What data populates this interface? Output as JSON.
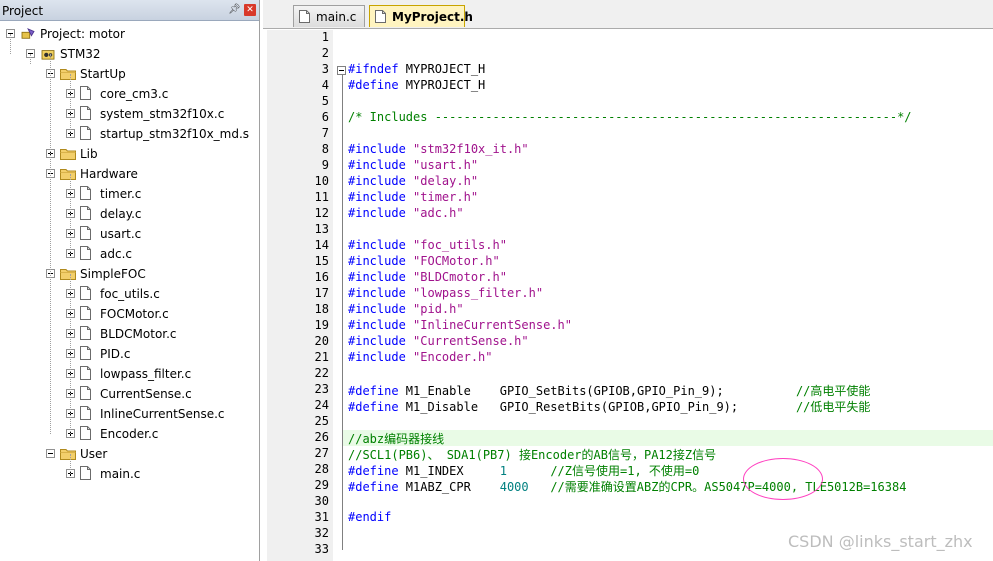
{
  "panel": {
    "title": "Project",
    "pin_icon": "pin-icon",
    "close_icon": "close-icon",
    "tree": {
      "project_label": "Project: motor",
      "target_label": "STM32",
      "groups": [
        {
          "label": "StartUp",
          "files": [
            "core_cm3.c",
            "system_stm32f10x.c",
            "startup_stm32f10x_md.s"
          ]
        },
        {
          "label": "Lib",
          "files": []
        },
        {
          "label": "Hardware",
          "files": [
            "timer.c",
            "delay.c",
            "usart.c",
            "adc.c"
          ]
        },
        {
          "label": "SimpleFOC",
          "files": [
            "foc_utils.c",
            "FOCMotor.c",
            "BLDCMotor.c",
            "PID.c",
            "lowpass_filter.c",
            "CurrentSense.c",
            "InlineCurrentSense.c",
            "Encoder.c"
          ]
        },
        {
          "label": "User",
          "files": [
            "main.c"
          ]
        }
      ]
    }
  },
  "tabs": [
    {
      "label": "main.c",
      "active": false
    },
    {
      "label": "MyProject.h",
      "active": true
    }
  ],
  "editor": {
    "line_numbers": [
      "1",
      "2",
      "3",
      "4",
      "5",
      "6",
      "7",
      "8",
      "9",
      "10",
      "11",
      "12",
      "13",
      "14",
      "15",
      "16",
      "17",
      "18",
      "19",
      "20",
      "21",
      "22",
      "23",
      "24",
      "25",
      "26",
      "27",
      "28",
      "29",
      "30",
      "31",
      "32",
      "33"
    ],
    "lines": [
      [],
      [],
      [
        [
          "kw",
          "#ifndef"
        ],
        [
          "p",
          " MYPROJECT_H"
        ]
      ],
      [
        [
          "kw",
          "#define"
        ],
        [
          "p",
          " MYPROJECT_H"
        ]
      ],
      [],
      [
        [
          "cmt",
          "/* Includes ----------------------------------------------------------------*/"
        ]
      ],
      [],
      [
        [
          "kw",
          "#include"
        ],
        [
          "p",
          " "
        ],
        [
          "str",
          "\"stm32f10x_it.h\""
        ]
      ],
      [
        [
          "kw",
          "#include"
        ],
        [
          "p",
          " "
        ],
        [
          "str",
          "\"usart.h\""
        ]
      ],
      [
        [
          "kw",
          "#include"
        ],
        [
          "p",
          " "
        ],
        [
          "str",
          "\"delay.h\""
        ]
      ],
      [
        [
          "kw",
          "#include"
        ],
        [
          "p",
          " "
        ],
        [
          "str",
          "\"timer.h\""
        ]
      ],
      [
        [
          "kw",
          "#include"
        ],
        [
          "p",
          " "
        ],
        [
          "str",
          "\"adc.h\""
        ]
      ],
      [],
      [
        [
          "kw",
          "#include"
        ],
        [
          "p",
          " "
        ],
        [
          "str",
          "\"foc_utils.h\""
        ]
      ],
      [
        [
          "kw",
          "#include"
        ],
        [
          "p",
          " "
        ],
        [
          "str",
          "\"FOCMotor.h\""
        ]
      ],
      [
        [
          "kw",
          "#include"
        ],
        [
          "p",
          " "
        ],
        [
          "str",
          "\"BLDCmotor.h\""
        ]
      ],
      [
        [
          "kw",
          "#include"
        ],
        [
          "p",
          " "
        ],
        [
          "str",
          "\"lowpass_filter.h\""
        ]
      ],
      [
        [
          "kw",
          "#include"
        ],
        [
          "p",
          " "
        ],
        [
          "str",
          "\"pid.h\""
        ]
      ],
      [
        [
          "kw",
          "#include"
        ],
        [
          "p",
          " "
        ],
        [
          "str",
          "\"InlineCurrentSense.h\""
        ]
      ],
      [
        [
          "kw",
          "#include"
        ],
        [
          "p",
          " "
        ],
        [
          "str",
          "\"CurrentSense.h\""
        ]
      ],
      [
        [
          "kw",
          "#include"
        ],
        [
          "p",
          " "
        ],
        [
          "str",
          "\"Encoder.h\""
        ]
      ],
      [],
      [
        [
          "kw",
          "#define"
        ],
        [
          "p",
          " M1_Enable    GPIO_SetBits(GPIOB,GPIO_Pin_9);          "
        ],
        [
          "cmt",
          "//高电平使能"
        ]
      ],
      [
        [
          "kw",
          "#define"
        ],
        [
          "p",
          " M1_Disable   GPIO_ResetBits(GPIOB,GPIO_Pin_9);        "
        ],
        [
          "cmt",
          "//低电平失能"
        ]
      ],
      [],
      [
        [
          "cmt",
          "//abz编码器接线"
        ]
      ],
      [
        [
          "cmt",
          "//SCL1(PB6)、 SDA1(PB7) 接Encoder的AB信号，PA12接Z信号"
        ]
      ],
      [
        [
          "kw",
          "#define"
        ],
        [
          "p",
          " M1_INDEX     "
        ],
        [
          "num",
          "1"
        ],
        [
          "p",
          "      "
        ],
        [
          "cmt",
          "//Z信号使用=1, 不使用=0"
        ]
      ],
      [
        [
          "kw",
          "#define"
        ],
        [
          "p",
          " M1ABZ_CPR    "
        ],
        [
          "num",
          "4000"
        ],
        [
          "p",
          "   "
        ],
        [
          "cmt",
          "//需要准确设置ABZ的CPR。AS5047P=4000, TLE5012B=16384"
        ]
      ],
      [],
      [
        [
          "kw",
          "#endif"
        ]
      ],
      [],
      []
    ],
    "highlight_line": 26
  },
  "watermark": "CSDN @links_start_zhx",
  "colors": {
    "keyword": "#0000ff",
    "string": "#a0128c",
    "comment": "#008000",
    "number": "#008080",
    "annotation": "#ff40c0",
    "close_button": "#d8392b"
  }
}
